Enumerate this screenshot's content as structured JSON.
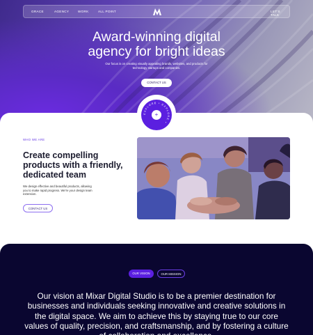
{
  "nav": {
    "items": [
      "Grace",
      "Agency",
      "Work",
      "All Point"
    ],
    "cta": "Let's Talk",
    "logo": "mixar-logo"
  },
  "hero": {
    "title_line1": "Award-winning digital",
    "title_line2": "agency for bright ideas",
    "subtitle": "Our focus is on creating visually appealing brands, websites, and products for technology startups and companies.",
    "button": "Contact Us"
  },
  "badge": {
    "ring_text": "EXPLORE • EXPLORE •",
    "icon": "plus-icon"
  },
  "about": {
    "eyebrow": "Who we are",
    "title": "Create compelling products with a friendly, dedicated team",
    "text": "We design effective and beautiful products, allowing you to make rapid progress. We're your design team extension.",
    "button": "Contact Us"
  },
  "mission": {
    "tab_vision": "Our Vision",
    "tab_mission": "Our Mission",
    "text": "Our vision at Mixar Digital Studio is to be a premier destination for businesses and individuals seeking innovative and creative solutions in the digital space. We aim to achieve this by staying true to our core values of quality, precision, and craftsmanship, and by fostering a culture of collaboration and excellence."
  },
  "colors": {
    "accent": "#5b1fe0",
    "dark": "#0a0630",
    "hero_purple": "#6a2be0"
  }
}
